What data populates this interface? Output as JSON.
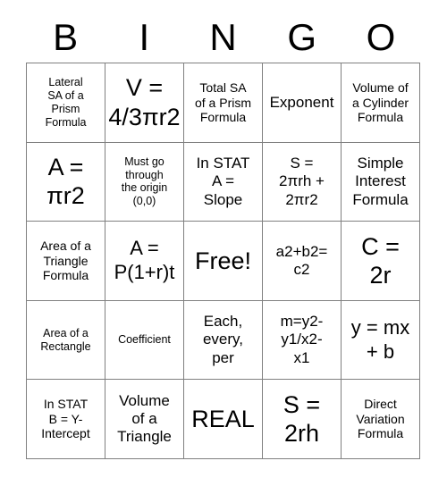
{
  "card": {
    "header_letters": [
      "B",
      "I",
      "N",
      "G",
      "O"
    ],
    "colors": {
      "background": "#ffffff",
      "border": "#808080",
      "text": "#000000"
    },
    "rows": [
      [
        {
          "text": "Lateral\nSA of a\nPrism\nFormula",
          "size": "xs"
        },
        {
          "text": "V =\n4/3πr2",
          "size": "xl"
        },
        {
          "text": "Total SA\nof a Prism\nFormula",
          "size": "sm"
        },
        {
          "text": "Exponent",
          "size": "md"
        },
        {
          "text": "Volume of\na Cylinder\nFormula",
          "size": "sm"
        }
      ],
      [
        {
          "text": "A =\nπr2",
          "size": "xl"
        },
        {
          "text": "Must go\nthrough\nthe origin\n(0,0)",
          "size": "xs"
        },
        {
          "text": "In STAT\nA =\nSlope",
          "size": "md"
        },
        {
          "text": "S =\n2πrh +\n2πr2",
          "size": "md"
        },
        {
          "text": "Simple\nInterest\nFormula",
          "size": "md"
        }
      ],
      [
        {
          "text": "Area of a\nTriangle\nFormula",
          "size": "sm"
        },
        {
          "text": "A =\nP(1+r)t",
          "size": "lg"
        },
        {
          "text": "Free!",
          "size": "xl"
        },
        {
          "text": "a2+b2=\nc2",
          "size": "md"
        },
        {
          "text": "C =\n2r",
          "size": "xl"
        }
      ],
      [
        {
          "text": "Area of a\nRectangle",
          "size": "xs"
        },
        {
          "text": "Coefficient",
          "size": "xs"
        },
        {
          "text": "Each,\nevery,\nper",
          "size": "md"
        },
        {
          "text": "m=y2-\ny1/x2-\nx1",
          "size": "md"
        },
        {
          "text": "y = mx\n+ b",
          "size": "lg"
        }
      ],
      [
        {
          "text": "In STAT\nB = Y-\nIntercept",
          "size": "sm"
        },
        {
          "text": "Volume\nof a\nTriangle",
          "size": "md"
        },
        {
          "text": "REAL",
          "size": "xl"
        },
        {
          "text": "S =\n2rh",
          "size": "xl"
        },
        {
          "text": "Direct\nVariation\nFormula",
          "size": "sm"
        }
      ]
    ]
  }
}
